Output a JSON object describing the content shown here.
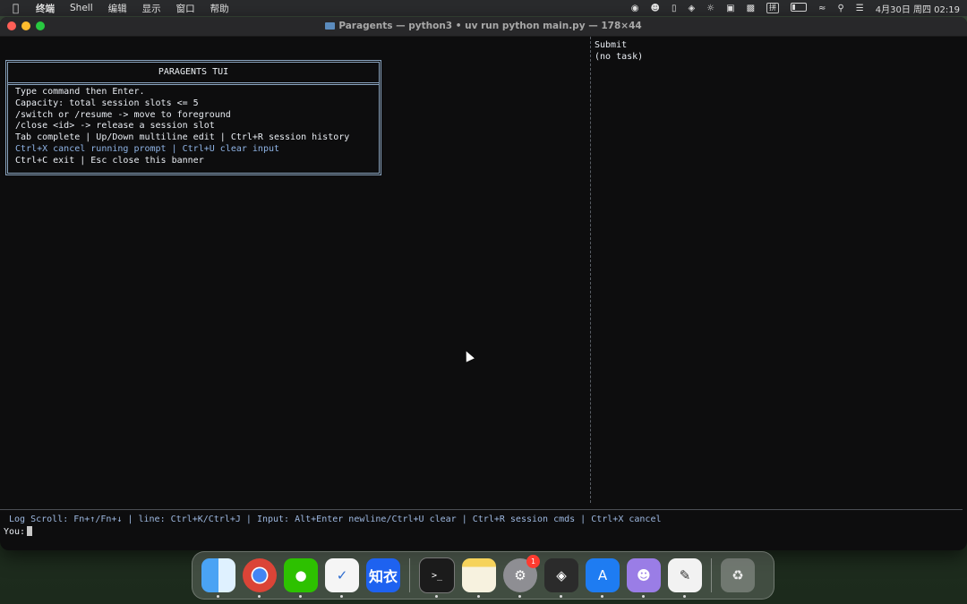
{
  "menubar": {
    "apple_icon": "apple-logo",
    "items": [
      "终端",
      "Shell",
      "编辑",
      "显示",
      "窗口",
      "帮助"
    ],
    "status_icons": [
      "record-icon",
      "cat-icon",
      "mouse-icon",
      "cube-icon",
      "wechat-icon",
      "text-icon",
      "screenshot-icon",
      "input-method-icon",
      "battery-icon",
      "wifi-icon",
      "search-icon",
      "control-center-icon"
    ],
    "input_method": "拼",
    "datetime": "4月30日 周四  02:19"
  },
  "window": {
    "title": "Paragents — python3 • uv run python main.py — 178×44"
  },
  "banner": {
    "title": "PARAGENTS TUI",
    "lines": [
      "Type command then Enter.",
      "Capacity: total session slots <= 5",
      "/switch or /resume -> move to foreground",
      "/close <id> -> release a session slot",
      "Tab complete | Up/Down multiline edit | Ctrl+R session history",
      "Ctrl+X cancel running prompt | Ctrl+U clear input",
      "Ctrl+C exit | Esc close this banner"
    ]
  },
  "side_panel": {
    "line1": "Submit",
    "line2": "(no task)"
  },
  "status_line": "Log Scroll: Fn+↑/Fn+↓ | line: Ctrl+K/Ctrl+J | Input: Alt+Enter newline/Ctrl+U clear | Ctrl+R session cmds | Ctrl+X cancel",
  "prompt": "You:",
  "dock": {
    "apps": [
      "finder-icon",
      "chrome-icon",
      "wechat-icon",
      "mail-icon",
      "zhiyi-icon",
      "terminal-icon",
      "notes-icon",
      "system-settings-icon",
      "cube-app-icon",
      "app-store-icon",
      "cat-app-icon",
      "textedit-icon",
      "trash-icon"
    ],
    "zhiyi_label": "知衣",
    "settings_badge": "1"
  }
}
